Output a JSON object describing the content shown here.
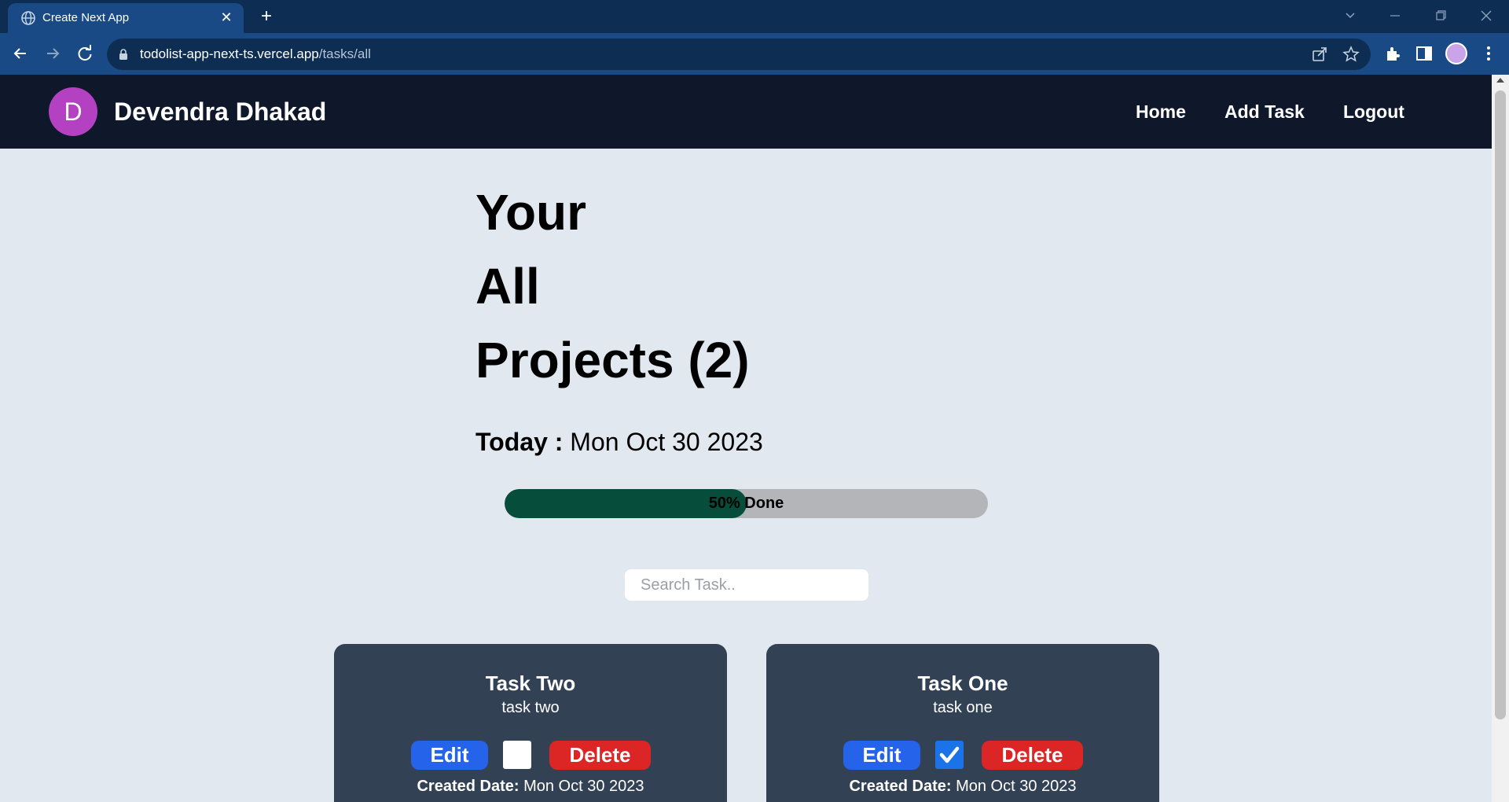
{
  "browser": {
    "tab_title": "Create Next App",
    "url_domain": "todolist-app-next-ts.vercel.app",
    "url_path": "/tasks/all"
  },
  "nav": {
    "avatar_letter": "D",
    "brand_name": "Devendra Dhakad",
    "links": [
      "Home",
      "Add Task",
      "Logout"
    ]
  },
  "page": {
    "heading_lines": [
      "Your",
      "All",
      "Projects (2)"
    ],
    "today_label": "Today :",
    "today_date": "Mon Oct 30 2023",
    "progress": {
      "percent": 50,
      "label": "50% Done"
    },
    "search_placeholder": "Search Task.."
  },
  "tasks": [
    {
      "title": "Task Two",
      "description": "task two",
      "done": false,
      "edit_label": "Edit",
      "delete_label": "Delete",
      "created_label": "Created Date:",
      "created_date": "Mon Oct 30 2023"
    },
    {
      "title": "Task One",
      "description": "task one",
      "done": true,
      "edit_label": "Edit",
      "delete_label": "Delete",
      "created_label": "Created Date:",
      "created_date": "Mon Oct 30 2023"
    }
  ],
  "colors": {
    "nav_bg": "#0f172a",
    "avatar": "#b441c1",
    "progress_fill": "#064e3b",
    "card_bg": "#334155",
    "edit": "#2563eb",
    "delete": "#dc2626",
    "checked": "#1a73e8"
  }
}
